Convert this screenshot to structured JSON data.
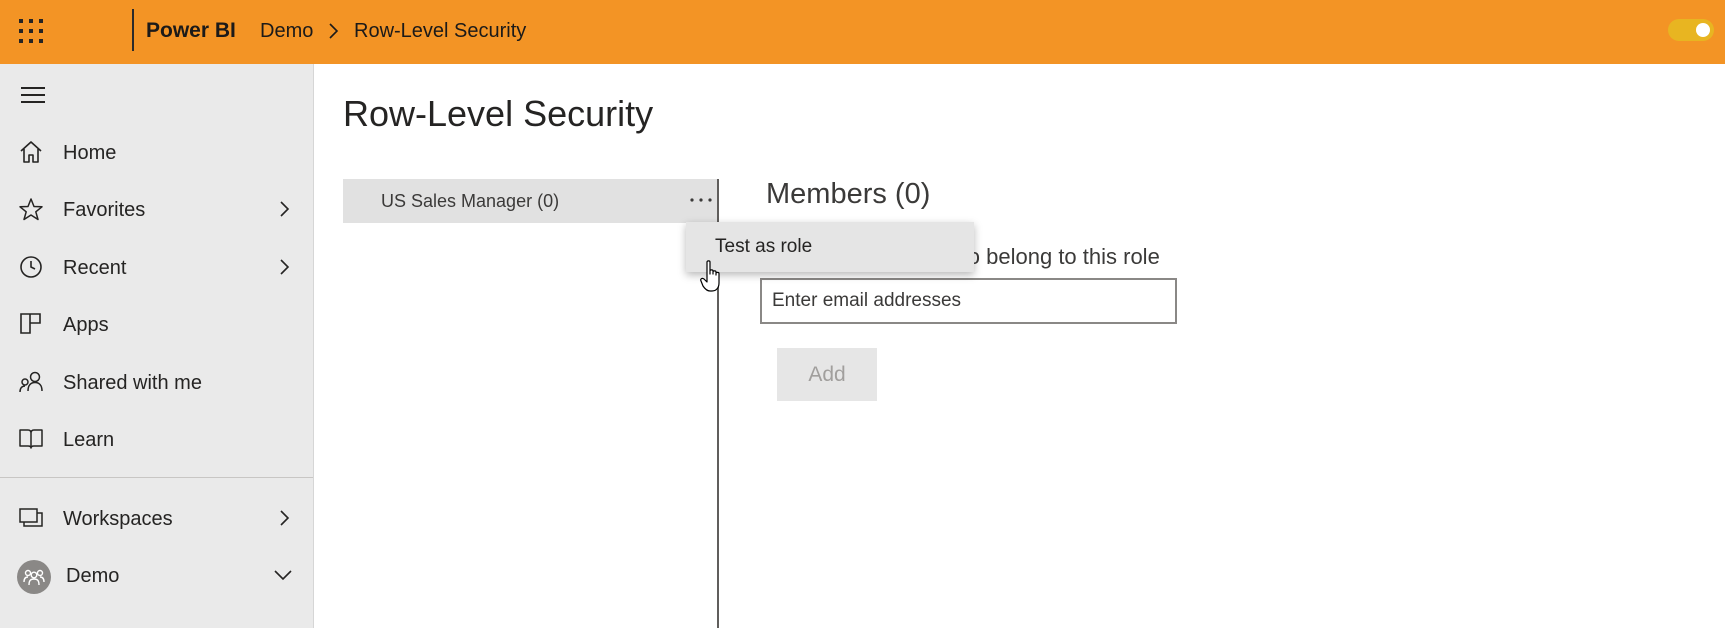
{
  "header": {
    "app_name": "Power BI",
    "breadcrumb": {
      "workspace": "Demo",
      "page": "Row-Level Security"
    },
    "accent_color": "#f39425"
  },
  "sidebar": {
    "items": [
      {
        "label": "Home",
        "icon": "home-icon"
      },
      {
        "label": "Favorites",
        "icon": "star-icon"
      },
      {
        "label": "Recent",
        "icon": "clock-icon"
      },
      {
        "label": "Apps",
        "icon": "apps-icon"
      },
      {
        "label": "Shared with me",
        "icon": "shared-icon"
      },
      {
        "label": "Learn",
        "icon": "book-icon"
      },
      {
        "label": "Workspaces",
        "icon": "workspaces-icon"
      },
      {
        "label": "Demo",
        "icon": "workspace-avatar-icon"
      }
    ]
  },
  "main": {
    "title": "Row-Level Security",
    "roles": [
      {
        "label": "US Sales Manager (0)"
      }
    ],
    "members": {
      "title": "Members (0)",
      "description": "People or groups who belong to this role",
      "email_placeholder": "Enter email addresses",
      "add_label": "Add"
    }
  },
  "context_menu": {
    "items": [
      {
        "label": "Test as role"
      }
    ]
  }
}
